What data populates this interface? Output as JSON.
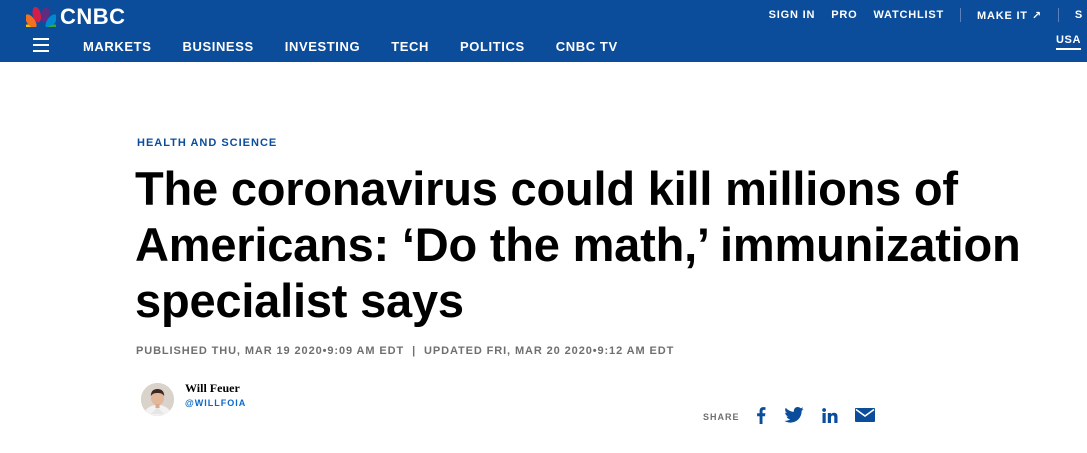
{
  "header": {
    "logo_text": "CNBC",
    "top_links": {
      "sign_in": "SIGN IN",
      "pro": "PRO",
      "watchlist": "WATCHLIST",
      "make_it": "MAKE IT",
      "make_it_arrow": "↗",
      "cut_off": "S"
    },
    "nav": [
      "MARKETS",
      "BUSINESS",
      "INVESTING",
      "TECH",
      "POLITICS",
      "CNBC TV"
    ],
    "edition": "USA",
    "colors": {
      "background": "#0b4c9b",
      "text": "#ffffff"
    }
  },
  "article": {
    "section": "HEALTH AND SCIENCE",
    "headline": "The coronavirus could kill millions of Americans: ‘Do the math,’ immunization specialist says",
    "published": "PUBLISHED THU, MAR 19 2020•9:09 AM EDT",
    "separator": "|",
    "updated": "UPDATED FRI, MAR 20 2020•9:12 AM EDT"
  },
  "author": {
    "name": "Will Feuer",
    "handle": "@WILLFOIA",
    "avatar_icon": "author-photo"
  },
  "share": {
    "label": "SHARE",
    "icons": [
      "facebook-icon",
      "twitter-icon",
      "linkedin-icon",
      "email-icon"
    ],
    "icon_color": "#0b4c9b"
  }
}
